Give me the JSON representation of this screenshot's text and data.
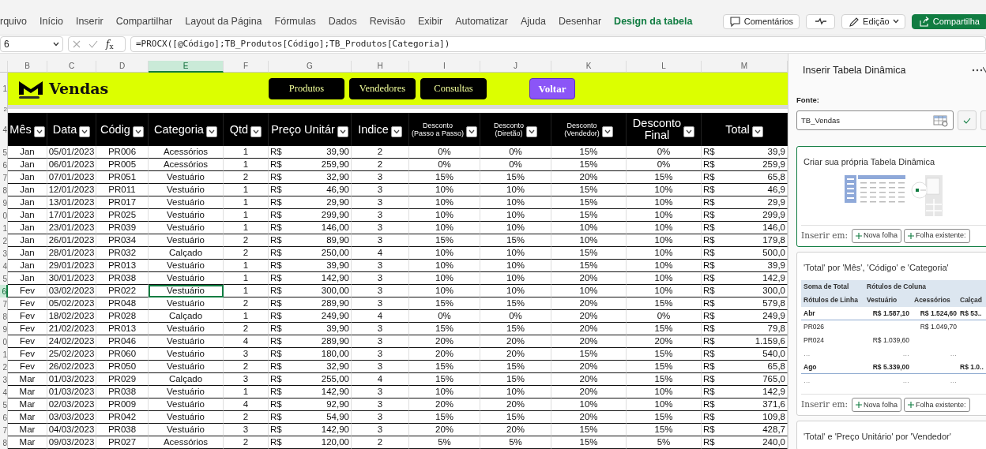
{
  "ribbon": {
    "tabs": [
      {
        "label": "rquivo",
        "selected": false
      },
      {
        "label": "Início",
        "selected": false
      },
      {
        "label": "Inserir",
        "selected": false
      },
      {
        "label": "Compartilhar",
        "selected": false
      },
      {
        "label": "Layout da Página",
        "selected": false
      },
      {
        "label": "Fórmulas",
        "selected": false
      },
      {
        "label": "Dados",
        "selected": false
      },
      {
        "label": "Revisão",
        "selected": false
      },
      {
        "label": "Exibir",
        "selected": false
      },
      {
        "label": "Automatizar",
        "selected": false
      },
      {
        "label": "Ajuda",
        "selected": false
      },
      {
        "label": "Desenhar",
        "selected": false
      },
      {
        "label": "Design da tabela",
        "selected": true
      }
    ],
    "buttons": [
      {
        "kind": "comments",
        "label": "Comentários"
      },
      {
        "kind": "activity"
      },
      {
        "kind": "editing",
        "label": "Edição"
      },
      {
        "kind": "share",
        "label": "Compartilha"
      }
    ]
  },
  "formula_bar": {
    "name_box": "6",
    "function_label": "*f*$_{x}$",
    "formula": "=PROCX([@Código];TB_Produtos[Código];TB_Produtos[Categoria])"
  },
  "sheet": {
    "column_headers": [
      {
        "label": "B",
        "selected": false
      },
      {
        "label": "C",
        "selected": false
      },
      {
        "label": "D",
        "selected": false
      },
      {
        "label": "E",
        "selected": true
      },
      {
        "label": "F",
        "selected": false
      },
      {
        "label": "G",
        "selected": false
      },
      {
        "label": "H",
        "selected": false
      },
      {
        "label": "I",
        "selected": false
      },
      {
        "label": "J",
        "selected": false
      },
      {
        "label": "K",
        "selected": false
      },
      {
        "label": "L",
        "selected": false
      },
      {
        "label": "M",
        "selected": false
      }
    ],
    "banner": {
      "row_number": "1",
      "title": "Vendas",
      "buttons": [
        {
          "label": "Produtos",
          "kind": "nav"
        },
        {
          "label": "Vendedores",
          "kind": "nav"
        },
        {
          "label": "Consultas",
          "kind": "nav"
        },
        {
          "label": "Voltar",
          "kind": "back"
        }
      ]
    },
    "spacer_row_number": "2",
    "header": {
      "row_number": "4",
      "columns": [
        {
          "kind": "large",
          "lines": [
            "Mês"
          ]
        },
        {
          "kind": "large",
          "lines": [
            "Data"
          ]
        },
        {
          "kind": "large",
          "lines": [
            "Códig"
          ]
        },
        {
          "kind": "large",
          "lines": [
            "Categoria"
          ]
        },
        {
          "kind": "large",
          "lines": [
            "Qtd"
          ]
        },
        {
          "kind": "large",
          "lines": [
            "Preço Unitár"
          ]
        },
        {
          "kind": "large",
          "lines": [
            "Indice"
          ]
        },
        {
          "kind": "small",
          "lines": [
            "Desconto",
            "(Passo a Passo)"
          ]
        },
        {
          "kind": "small",
          "lines": [
            "Desconto",
            "(Diretão)"
          ]
        },
        {
          "kind": "small",
          "lines": [
            "Desconto",
            "(Vendedor)"
          ]
        },
        {
          "kind": "large",
          "lines": [
            "Desconto",
            "Final"
          ]
        },
        {
          "kind": "large",
          "lines": [
            "Total"
          ]
        }
      ]
    },
    "rows": [
      {
        "row_number": "5",
        "selected": false,
        "cells": [
          "Jan",
          "05/01/2023",
          "PR006",
          "Acessórios",
          "1",
          {
            "symbol": "R$",
            "amount": "39,90"
          },
          "2",
          "0%",
          "0%",
          "15%",
          "0%",
          {
            "symbol": "R$",
            "amount": "39,9"
          }
        ]
      },
      {
        "row_number": "6",
        "selected": false,
        "cells": [
          "Jan",
          "06/01/2023",
          "PR005",
          "Acessórios",
          "1",
          {
            "symbol": "R$",
            "amount": "259,90"
          },
          "2",
          "0%",
          "0%",
          "15%",
          "0%",
          {
            "symbol": "R$",
            "amount": "259,9"
          }
        ]
      },
      {
        "row_number": "7",
        "selected": false,
        "cells": [
          "Jan",
          "07/01/2023",
          "PR051",
          "Vestuário",
          "2",
          {
            "symbol": "R$",
            "amount": "32,90"
          },
          "3",
          "15%",
          "15%",
          "20%",
          "15%",
          {
            "symbol": "R$",
            "amount": "65,8"
          }
        ]
      },
      {
        "row_number": "8",
        "selected": false,
        "cells": [
          "Jan",
          "12/01/2023",
          "PR011",
          "Vestuário",
          "1",
          {
            "symbol": "R$",
            "amount": "46,90"
          },
          "3",
          "10%",
          "10%",
          "15%",
          "10%",
          {
            "symbol": "R$",
            "amount": "46,9"
          }
        ]
      },
      {
        "row_number": "9",
        "selected": false,
        "cells": [
          "Jan",
          "13/01/2023",
          "PR017",
          "Vestuário",
          "1",
          {
            "symbol": "R$",
            "amount": "29,90"
          },
          "3",
          "10%",
          "10%",
          "15%",
          "10%",
          {
            "symbol": "R$",
            "amount": "29,9"
          }
        ]
      },
      {
        "row_number": "0",
        "selected": false,
        "cells": [
          "Jan",
          "17/01/2023",
          "PR025",
          "Vestuário",
          "1",
          {
            "symbol": "R$",
            "amount": "299,90"
          },
          "3",
          "10%",
          "10%",
          "15%",
          "10%",
          {
            "symbol": "R$",
            "amount": "299,9"
          }
        ]
      },
      {
        "row_number": "1",
        "selected": false,
        "cells": [
          "Jan",
          "23/01/2023",
          "PR039",
          "Vestuário",
          "1",
          {
            "symbol": "R$",
            "amount": "146,00"
          },
          "3",
          "10%",
          "10%",
          "10%",
          "10%",
          {
            "symbol": "R$",
            "amount": "146,0"
          }
        ]
      },
      {
        "row_number": "2",
        "selected": false,
        "cells": [
          "Jan",
          "26/01/2023",
          "PR034",
          "Vestuário",
          "2",
          {
            "symbol": "R$",
            "amount": "89,90"
          },
          "3",
          "15%",
          "15%",
          "10%",
          "10%",
          {
            "symbol": "R$",
            "amount": "179,8"
          }
        ]
      },
      {
        "row_number": "3",
        "selected": false,
        "cells": [
          "Jan",
          "28/01/2023",
          "PR032",
          "Calçado",
          "2",
          {
            "symbol": "R$",
            "amount": "250,00"
          },
          "4",
          "10%",
          "10%",
          "15%",
          "10%",
          {
            "symbol": "R$",
            "amount": "500,0"
          }
        ]
      },
      {
        "row_number": "4",
        "selected": false,
        "cells": [
          "Jan",
          "29/01/2023",
          "PR013",
          "Vestuário",
          "1",
          {
            "symbol": "R$",
            "amount": "39,90"
          },
          "3",
          "10%",
          "10%",
          "15%",
          "10%",
          {
            "symbol": "R$",
            "amount": "39,9"
          }
        ]
      },
      {
        "row_number": "5",
        "selected": false,
        "cells": [
          "Jan",
          "30/01/2023",
          "PR038",
          "Vestuário",
          "1",
          {
            "symbol": "R$",
            "amount": "142,90"
          },
          "3",
          "10%",
          "10%",
          "20%",
          "10%",
          {
            "symbol": "R$",
            "amount": "142,9"
          }
        ]
      },
      {
        "row_number": "6",
        "selected": true,
        "cells": [
          "Fev",
          "03/02/2023",
          "PR022",
          "Vestuário",
          "1",
          {
            "symbol": "R$",
            "amount": "300,00"
          },
          "3",
          "10%",
          "10%",
          "10%",
          "10%",
          {
            "symbol": "R$",
            "amount": "300,0"
          }
        ]
      },
      {
        "row_number": "7",
        "selected": false,
        "cells": [
          "Fev",
          "05/02/2023",
          "PR048",
          "Vestuário",
          "2",
          {
            "symbol": "R$",
            "amount": "289,90"
          },
          "3",
          "15%",
          "15%",
          "20%",
          "15%",
          {
            "symbol": "R$",
            "amount": "579,8"
          }
        ]
      },
      {
        "row_number": "8",
        "selected": false,
        "cells": [
          "Fev",
          "18/02/2023",
          "PR028",
          "Calçado",
          "1",
          {
            "symbol": "R$",
            "amount": "249,90"
          },
          "4",
          "0%",
          "0%",
          "20%",
          "0%",
          {
            "symbol": "R$",
            "amount": "249,9"
          }
        ]
      },
      {
        "row_number": "9",
        "selected": false,
        "cells": [
          "Fev",
          "21/02/2023",
          "PR013",
          "Vestuário",
          "2",
          {
            "symbol": "R$",
            "amount": "39,90"
          },
          "3",
          "15%",
          "15%",
          "20%",
          "15%",
          {
            "symbol": "R$",
            "amount": "79,8"
          }
        ]
      },
      {
        "row_number": "0",
        "selected": false,
        "cells": [
          "Fev",
          "24/02/2023",
          "PR046",
          "Vestuário",
          "4",
          {
            "symbol": "R$",
            "amount": "289,90"
          },
          "3",
          "20%",
          "20%",
          "20%",
          "20%",
          {
            "symbol": "R$",
            "amount": "1.159,6"
          }
        ]
      },
      {
        "row_number": "1",
        "selected": false,
        "cells": [
          "Fev",
          "25/02/2023",
          "PR060",
          "Vestuário",
          "3",
          {
            "symbol": "R$",
            "amount": "180,00"
          },
          "3",
          "20%",
          "20%",
          "15%",
          "15%",
          {
            "symbol": "R$",
            "amount": "540,0"
          }
        ]
      },
      {
        "row_number": "2",
        "selected": false,
        "cells": [
          "Fev",
          "26/02/2023",
          "PR050",
          "Vestuário",
          "2",
          {
            "symbol": "R$",
            "amount": "32,90"
          },
          "3",
          "15%",
          "15%",
          "20%",
          "15%",
          {
            "symbol": "R$",
            "amount": "65,8"
          }
        ]
      },
      {
        "row_number": "3",
        "selected": false,
        "cells": [
          "Mar",
          "01/03/2023",
          "PR029",
          "Calçado",
          "3",
          {
            "symbol": "R$",
            "amount": "255,00"
          },
          "4",
          "15%",
          "15%",
          "20%",
          "15%",
          {
            "symbol": "R$",
            "amount": "765,0"
          }
        ]
      },
      {
        "row_number": "4",
        "selected": false,
        "cells": [
          "Mar",
          "01/03/2023",
          "PR038",
          "Vestuário",
          "1",
          {
            "symbol": "R$",
            "amount": "142,90"
          },
          "3",
          "10%",
          "10%",
          "20%",
          "10%",
          {
            "symbol": "R$",
            "amount": "142,9"
          }
        ]
      },
      {
        "row_number": "5",
        "selected": false,
        "cells": [
          "Mar",
          "02/03/2023",
          "PR009",
          "Vestuário",
          "4",
          {
            "symbol": "R$",
            "amount": "92,90"
          },
          "3",
          "20%",
          "20%",
          "10%",
          "10%",
          {
            "symbol": "R$",
            "amount": "371,6"
          }
        ]
      },
      {
        "row_number": "6",
        "selected": false,
        "cells": [
          "Mar",
          "03/03/2023",
          "PR042",
          "Vestuário",
          "2",
          {
            "symbol": "R$",
            "amount": "54,90"
          },
          "3",
          "15%",
          "15%",
          "20%",
          "15%",
          {
            "symbol": "R$",
            "amount": "109,8"
          }
        ]
      },
      {
        "row_number": "7",
        "selected": false,
        "cells": [
          "Mar",
          "04/03/2023",
          "PR038",
          "Vestuário",
          "3",
          {
            "symbol": "R$",
            "amount": "142,90"
          },
          "3",
          "20%",
          "20%",
          "15%",
          "15%",
          {
            "symbol": "R$",
            "amount": "428,7"
          }
        ]
      },
      {
        "row_number": "8",
        "selected": false,
        "cells": [
          "Mar",
          "09/03/2023",
          "PR027",
          "Acessórios",
          "2",
          {
            "symbol": "R$",
            "amount": "120,00"
          },
          "2",
          "5%",
          "5%",
          "15%",
          "5%",
          {
            "symbol": "R$",
            "amount": "240,0"
          }
        ]
      }
    ]
  },
  "pane": {
    "title": "Inserir Tabela Dinâmica",
    "source_label": "Fonte:",
    "source_value": "TB_Vendas",
    "cards": [
      {
        "kind": "custom",
        "selected": true,
        "title": "Criar sua própria Tabela Dinâmica",
        "insert_label": "Inserir em:",
        "insert_buttons": [
          "Nova folha",
          "Folha existente:"
        ]
      },
      {
        "kind": "preview",
        "selected": false,
        "title": "'Total' por 'Mês', 'Código' e 'Categoria'",
        "insert_label": "Inserir em:",
        "insert_buttons": [
          "Nova folha",
          "Folha existente:"
        ],
        "pivot": {
          "header_rows": [
            [
              "Soma de Total",
              "Rótulos de Coluna"
            ],
            [
              "Rótulos de Linha",
              "Vestuário",
              "Acessórios",
              "Calçad"
            ]
          ],
          "rows": [
            {
              "kind": "group",
              "cells": [
                "Abr",
                "R$ 1.587,10",
                "R$ 1.524,60",
                "R$ 53.."
              ]
            },
            {
              "kind": "item",
              "cells": [
                "PR026",
                "",
                "R$ 1.049,70",
                ""
              ]
            },
            {
              "kind": "item",
              "cells": [
                "PR024",
                "R$ 1.039,60",
                "",
                ""
              ]
            },
            {
              "kind": "more",
              "cells": [
                "…",
                "…",
                "…",
                ""
              ]
            },
            {
              "kind": "group",
              "cells": [
                "Ago",
                "R$ 5.339,00",
                "",
                "R$ 1.0.."
              ]
            },
            {
              "kind": "more",
              "cells": [
                "…",
                "…",
                "…",
                ""
              ]
            }
          ]
        }
      },
      {
        "kind": "preview",
        "selected": false,
        "title": "'Total' e 'Preço Unitário' por 'Vendedor'"
      }
    ]
  }
}
